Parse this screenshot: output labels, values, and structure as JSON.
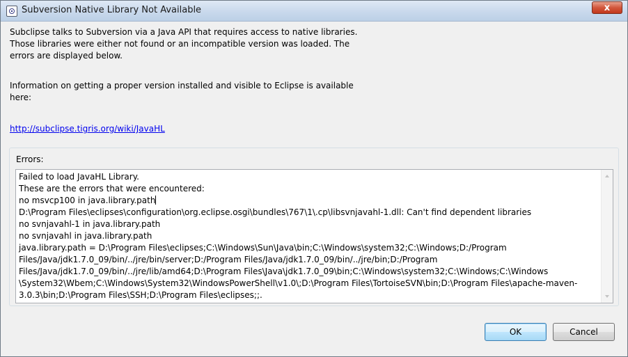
{
  "window": {
    "title": "Subversion Native Library Not Available",
    "close_label": "x"
  },
  "message": {
    "lines": [
      "Subclipse talks to Subversion via a Java API that requires access to native libraries.",
      "Those libraries were either not found or an incompatible version was loaded.  The",
      "errors are displayed below."
    ],
    "info_lines": [
      "Information on getting a proper version installed and visible to Eclipse is available",
      "here:"
    ],
    "link": "http://subclipse.tigris.org/wiki/JavaHL"
  },
  "errors_group": {
    "title": "Errors:",
    "lines": [
      "Failed to load JavaHL Library.",
      "These are the errors that were encountered:",
      "no msvcp100 in java.library.path",
      "D:\\Program Files\\eclipses\\configuration\\org.eclipse.osgi\\bundles\\767\\1\\.cp\\libsvnjavahl-1.dll: Can't find dependent libraries",
      "no svnjavahl-1 in java.library.path",
      "no svnjavahl in java.library.path",
      "java.library.path = D:\\Program Files\\eclipses;C:\\Windows\\Sun\\Java\\bin;C:\\Windows\\system32;C:\\Windows;D:/Program",
      "Files/Java/jdk1.7.0_09/bin/../jre/bin/server;D:/Program Files/Java/jdk1.7.0_09/bin/../jre/bin;D:/Program",
      "Files/Java/jdk1.7.0_09/bin/../jre/lib/amd64;D:\\Program Files\\Java\\jdk1.7.0_09\\bin;C:\\Windows\\system32;C:\\Windows;C:\\Windows",
      "\\System32\\Wbem;C:\\Windows\\System32\\WindowsPowerShell\\v1.0\\;D:\\Program Files\\TortoiseSVN\\bin;D:\\Program Files\\apache-maven-",
      "3.0.3\\bin;D:\\Program Files\\SSH;D:\\Program Files\\eclipses;;."
    ]
  },
  "buttons": {
    "ok": "OK",
    "cancel": "Cancel"
  }
}
